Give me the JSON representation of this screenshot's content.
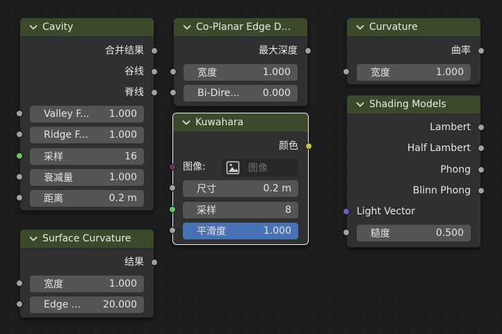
{
  "nodes": {
    "cavity": {
      "title": "Cavity",
      "outputs": [
        "合并结果",
        "谷线",
        "脊线"
      ],
      "fields": [
        {
          "label": "Valley F...",
          "value": "1.000"
        },
        {
          "label": "Ridge F...",
          "value": "1.000"
        },
        {
          "label": "采样",
          "value": "16"
        },
        {
          "label": "衰减量",
          "value": "1.000"
        },
        {
          "label": "距离",
          "value": "0.2 m"
        }
      ]
    },
    "coplanar": {
      "title": "Co-Planar Edge D...",
      "outputs": [
        "最大深度"
      ],
      "fields": [
        {
          "label": "宽度",
          "value": "1.000"
        },
        {
          "label": "Bi-Dire...",
          "value": "0.000"
        }
      ]
    },
    "curvature": {
      "title": "Curvature",
      "outputs": [
        "曲率"
      ],
      "fields": [
        {
          "label": "宽度",
          "value": "1.000"
        }
      ]
    },
    "kuwahara": {
      "title": "Kuwahara",
      "outputs": [
        "颜色"
      ],
      "image_label": "图像:",
      "image_placeholder": "图像",
      "fields": [
        {
          "label": "尺寸",
          "value": "0.2 m"
        },
        {
          "label": "采样",
          "value": "8"
        },
        {
          "label": "平滑度",
          "value": "1.000"
        }
      ]
    },
    "shading": {
      "title": "Shading Models",
      "outputs": [
        "Lambert",
        "Half Lambert",
        "Phong",
        "Blinn Phong"
      ],
      "input_label": "Light Vector",
      "fields": [
        {
          "label": "糙度",
          "value": "0.500"
        }
      ]
    },
    "surface": {
      "title": "Surface Curvature",
      "outputs": [
        "结果"
      ],
      "fields": [
        {
          "label": "宽度",
          "value": "1.000"
        },
        {
          "label": "Edge ...",
          "value": "20.000"
        }
      ]
    }
  },
  "colors": {
    "header": "#3b4a2a",
    "socket_float": "#a1a1a1",
    "socket_int": "#63c763",
    "socket_color": "#c7c729",
    "socket_shader_image": "#633863",
    "socket_vector": "#6363c7",
    "active_field": "#4772b3"
  }
}
